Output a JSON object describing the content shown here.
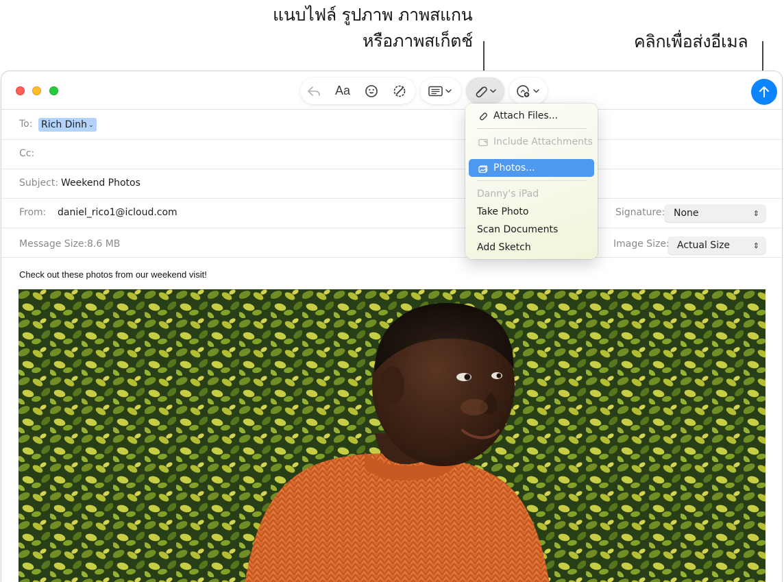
{
  "callouts": {
    "attach_line1": "แนบไฟล์ รูปภาพ ภาพสแกน",
    "attach_line2": "หรือภาพสเก็ตช์",
    "send": "คลิกเพื่อส่งอีเมล"
  },
  "toolbar": {
    "reply_icon": "reply-icon",
    "font_label": "Aa",
    "emoji_icon": "emoji-icon",
    "writing_tools_icon": "writing-tools-icon",
    "header_fields_icon": "header-fields-icon",
    "attach_icon": "paperclip-icon",
    "photo_browser_icon": "photo-browser-icon",
    "send_icon": "send-arrow-icon",
    "accent": "#0b84ff"
  },
  "compose": {
    "to_label": "To:",
    "to_recipient": "Rich Dinh",
    "cc_label": "Cc:",
    "subject_label": "Subject:",
    "subject_value": "Weekend Photos",
    "from_label": "From:",
    "from_value": "daniel_rico1@icloud.com",
    "signature_label": "Signature:",
    "signature_value": "None",
    "message_size_label": "Message Size:",
    "message_size_value": "8.6 MB",
    "image_size_label": "Image Size:",
    "image_size_value": "Actual Size",
    "body": "Check out these photos from our weekend visit!"
  },
  "attach_menu": {
    "attach_files": "Attach Files...",
    "include_attachments": "Include Attachments",
    "photos": "Photos...",
    "device_header": "Danny's iPad",
    "take_photo": "Take Photo",
    "scan_documents": "Scan Documents",
    "add_sketch": "Add Sketch",
    "selected_color": "#4f98f0"
  }
}
